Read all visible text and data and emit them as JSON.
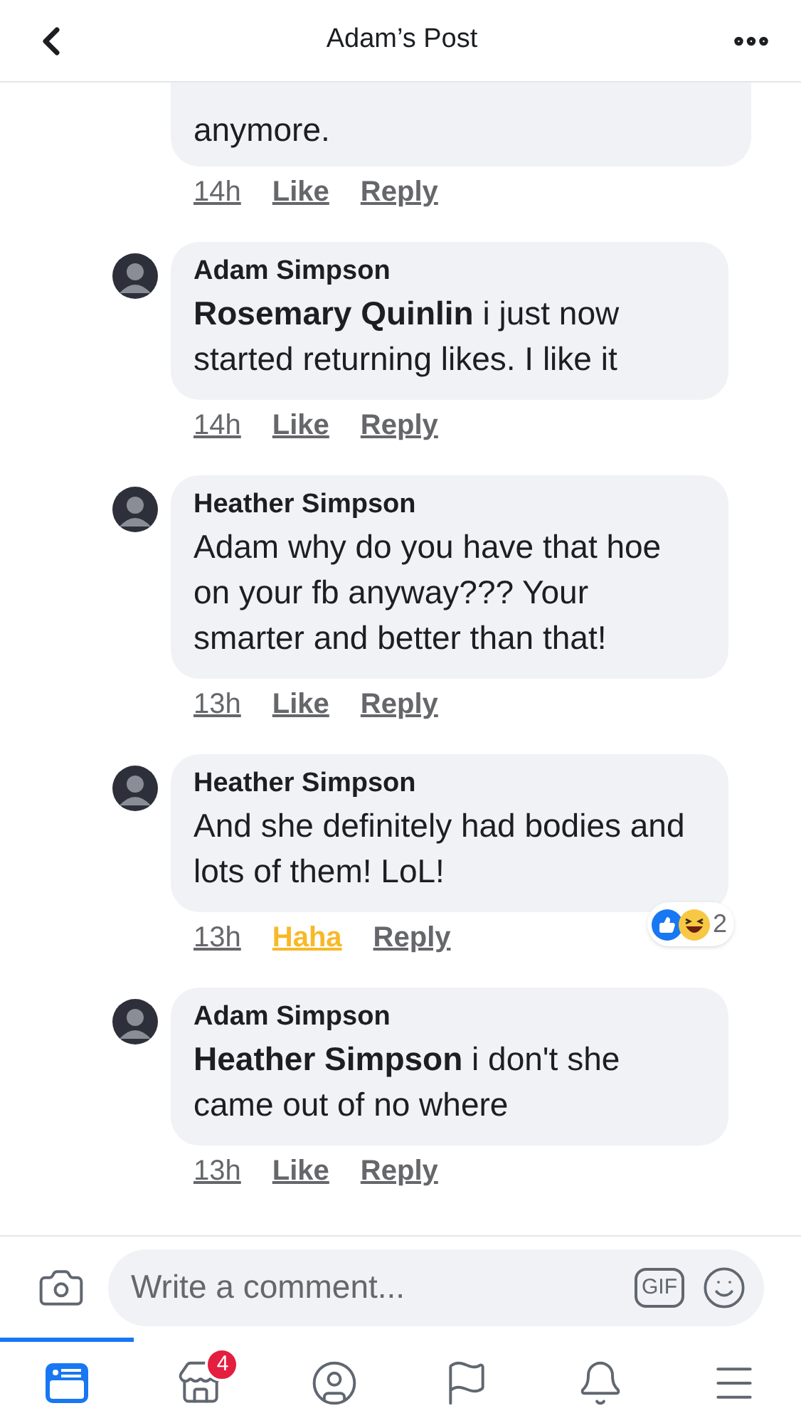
{
  "header": {
    "title": "Adam’s Post"
  },
  "partial_comment": {
    "lines": [
      "anymore."
    ],
    "time": "14h",
    "like": "Like",
    "reacted": false,
    "reply": "Reply"
  },
  "replies": [
    {
      "author": "Adam Simpson",
      "text": "**Rosemary Quinlin** i just now started returning likes. I like it",
      "time": "14h",
      "like": "Like",
      "reacted": false,
      "reply": "Reply"
    },
    {
      "author": "Heather Simpson",
      "text": "Adam why do you have that hoe on your fb anyway??? Your smarter and better than that!",
      "time": "13h",
      "like": "Like",
      "reacted": false,
      "reply": "Reply"
    },
    {
      "author": "Heather Simpson",
      "text": "And she definitely had bodies and lots of them! LoL!",
      "time": "13h",
      "like": "Haha",
      "reacted": true,
      "reply": "Reply",
      "reaction_count": "2"
    },
    {
      "author": "Adam Simpson",
      "text": "**Heather Simpson** i don't she came out of no where",
      "time": "13h",
      "like": "Like",
      "reacted": false,
      "reply": "Reply"
    }
  ],
  "composer": {
    "placeholder": "Write a comment...",
    "gif": "GIF"
  },
  "tabs": [
    {
      "kind": "feed",
      "selected": true
    },
    {
      "kind": "store",
      "selected": false,
      "badge": "4"
    },
    {
      "kind": "profile",
      "selected": false
    },
    {
      "kind": "flag",
      "selected": false
    },
    {
      "kind": "bell",
      "selected": false
    },
    {
      "kind": "menu",
      "selected": false
    }
  ]
}
